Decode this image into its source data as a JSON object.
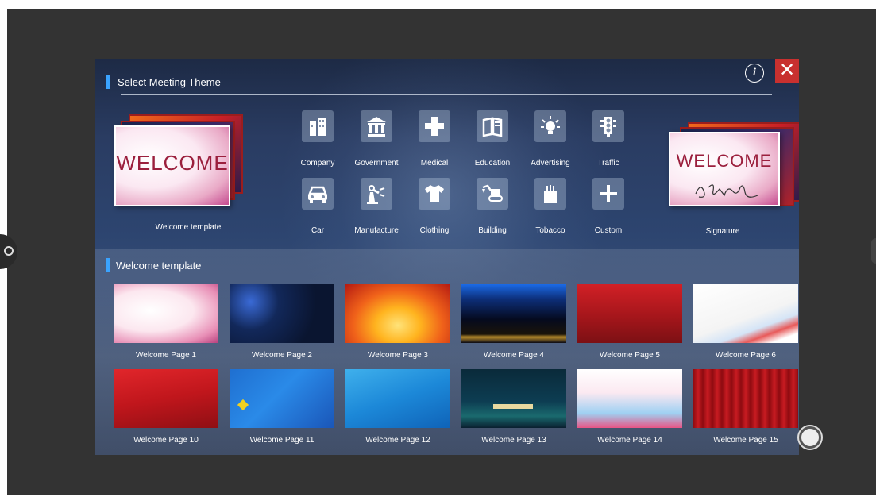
{
  "dialog": {
    "title": "Select Meeting Theme",
    "info_icon_glyph": "i",
    "close_icon_glyph": "✕",
    "accent_color": "#3aa3ff",
    "close_color": "#c8302f"
  },
  "welcome_card": {
    "text": "WELCOME",
    "label": "Welcome template"
  },
  "signature_card": {
    "text": "WELCOME",
    "label": "Signature"
  },
  "categories": [
    {
      "label": "Company",
      "icon": "building-icon"
    },
    {
      "label": "Government",
      "icon": "government-icon"
    },
    {
      "label": "Medical",
      "icon": "medical-cross-icon"
    },
    {
      "label": "Education",
      "icon": "book-icon"
    },
    {
      "label": "Advertising",
      "icon": "lightbulb-icon"
    },
    {
      "label": "Traffic",
      "icon": "traffic-light-icon"
    },
    {
      "label": "Car",
      "icon": "car-icon"
    },
    {
      "label": "Manufacture",
      "icon": "robot-arm-icon"
    },
    {
      "label": "Clothing",
      "icon": "tshirt-icon"
    },
    {
      "label": "Building",
      "icon": "excavator-icon"
    },
    {
      "label": "Tobacco",
      "icon": "cigarette-pack-icon"
    },
    {
      "label": "Custom",
      "icon": "plus-icon"
    }
  ],
  "template_section": {
    "title": "Welcome template",
    "templates": [
      {
        "label": "Welcome Page 1"
      },
      {
        "label": "Welcome Page 2"
      },
      {
        "label": "Welcome Page 3"
      },
      {
        "label": "Welcome Page 4"
      },
      {
        "label": "Welcome Page 5"
      },
      {
        "label": "Welcome Page 6"
      },
      {
        "label": "Welcome Page 10"
      },
      {
        "label": "Welcome Page 11"
      },
      {
        "label": "Welcome Page 12"
      },
      {
        "label": "Welcome Page 13"
      },
      {
        "label": "Welcome Page 14"
      },
      {
        "label": "Welcome Page 15"
      }
    ]
  }
}
